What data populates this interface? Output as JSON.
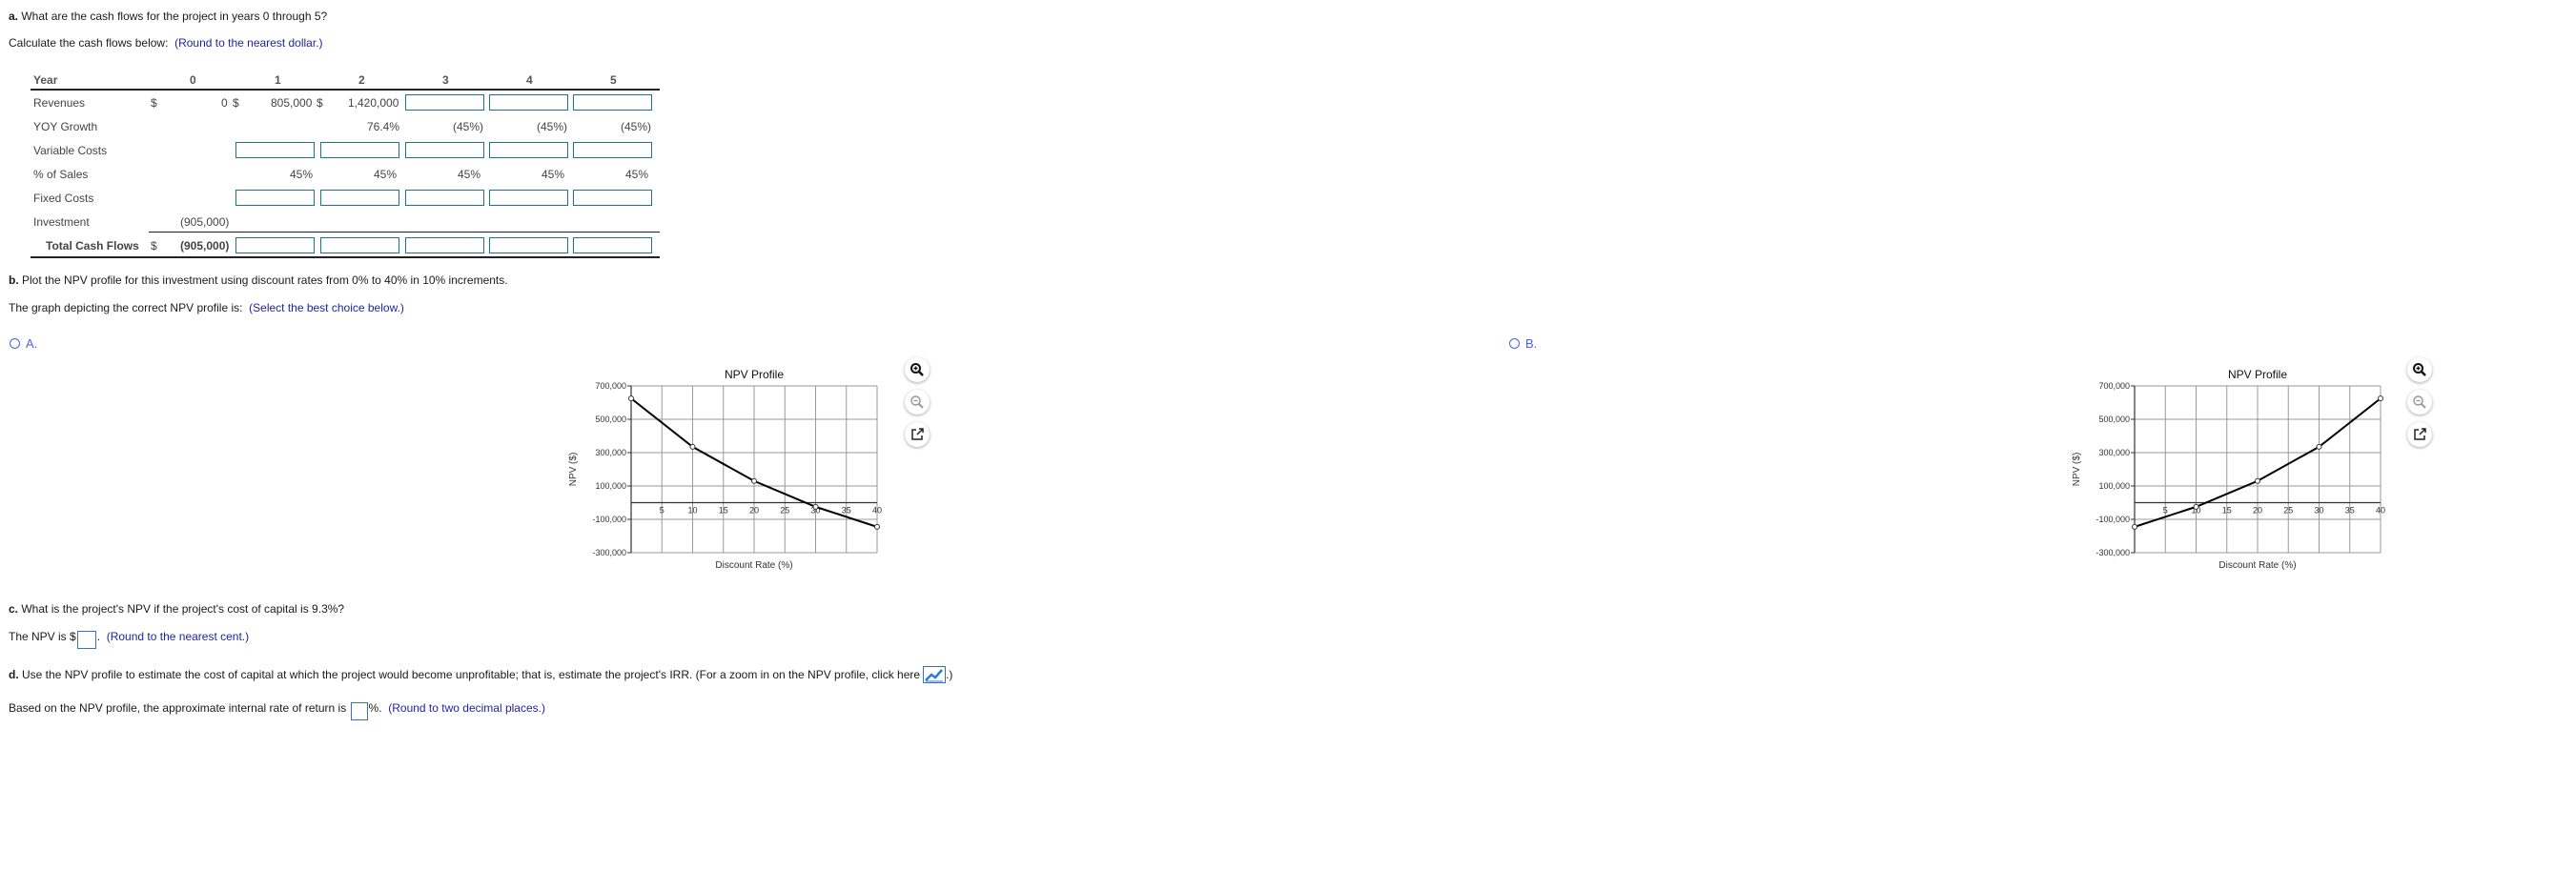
{
  "part_a": {
    "question_letter": "a.",
    "question": " What are the cash flows for the project in years 0 through 5?",
    "instruction": "Calculate the cash flows below:",
    "hint": "(Round to the nearest dollar.)"
  },
  "table": {
    "year_label": "Year",
    "years": [
      "0",
      "1",
      "2",
      "3",
      "4",
      "5"
    ],
    "rows": {
      "revenues": {
        "label": "Revenues",
        "currency": "$",
        "y0": "0",
        "y1": "805,000",
        "y2": "1,420,000",
        "dollar_y0": "$",
        "dollar_y1": "$"
      },
      "yoy_growth": {
        "label": "YOY Growth",
        "y2": "76.4%",
        "y3": "(45%)",
        "y4": "(45%)",
        "y5": "(45%)"
      },
      "variable_costs": {
        "label": "Variable Costs"
      },
      "pct_of_sales": {
        "label": "% of Sales",
        "y1": "45%",
        "y2": "45%",
        "y3": "45%",
        "y4": "45%",
        "y5": "45%"
      },
      "fixed_costs": {
        "label": "Fixed Costs"
      },
      "investment": {
        "label": "Investment",
        "y0": "(905,000)"
      },
      "total_cash_flows": {
        "label": "Total Cash Flows",
        "currency": "$",
        "y0": "(905,000)"
      }
    }
  },
  "part_b": {
    "question_letter": "b.",
    "question": " Plot the NPV profile for this investment using discount rates from 0% to 40% in 10% increments.",
    "instruction": "The graph depicting the correct NPV profile is:",
    "hint": "(Select the best choice below.)",
    "options": [
      {
        "label": "A."
      },
      {
        "label": "B."
      }
    ]
  },
  "chart_data": [
    {
      "type": "line",
      "option": "A",
      "title": "NPV Profile",
      "xlabel": "Discount Rate (%)",
      "ylabel": "NPV ($)",
      "x": [
        0,
        10,
        20,
        30,
        40
      ],
      "series": [
        {
          "name": "NPV",
          "values": [
            625000,
            335000,
            130000,
            -25000,
            -145000
          ]
        }
      ],
      "xlim": [
        0,
        40
      ],
      "ylim": [
        -300000,
        700000
      ],
      "xticks": [
        "5",
        "10",
        "15",
        "20",
        "25",
        "30",
        "35",
        "40"
      ],
      "xtick_values": [
        5,
        10,
        15,
        20,
        25,
        30,
        35,
        40
      ],
      "yticks": [
        "700,000",
        "500,000",
        "300,000",
        "100,000",
        "-100,000",
        "-300,000"
      ],
      "ytick_values": [
        700000,
        500000,
        300000,
        100000,
        -100000,
        -300000
      ],
      "grid": true
    },
    {
      "type": "line",
      "option": "B",
      "title": "NPV Profile",
      "xlabel": "Discount Rate (%)",
      "ylabel": "NPV ($)",
      "x": [
        0,
        10,
        20,
        30,
        40
      ],
      "series": [
        {
          "name": "NPV",
          "values": [
            -145000,
            -25000,
            130000,
            335000,
            625000
          ]
        }
      ],
      "xlim": [
        0,
        40
      ],
      "ylim": [
        -300000,
        700000
      ],
      "xticks": [
        "5",
        "10",
        "15",
        "20",
        "25",
        "30",
        "35",
        "40"
      ],
      "xtick_values": [
        5,
        10,
        15,
        20,
        25,
        30,
        35,
        40
      ],
      "yticks": [
        "700,000",
        "500,000",
        "300,000",
        "100,000",
        "-100,000",
        "-300,000"
      ],
      "ytick_values": [
        700000,
        500000,
        300000,
        100000,
        -100000,
        -300000
      ],
      "grid": true
    }
  ],
  "chart_icons": [
    "zoom-in-icon",
    "zoom-out-icon",
    "open-external-icon"
  ],
  "part_c": {
    "question_letter": "c.",
    "question": " What is the project's NPV if the project's cost of capital is 9.3%?",
    "answer_prefix": "The NPV is $",
    "answer_suffix": ".",
    "hint": "(Round to the nearest cent.)"
  },
  "part_d": {
    "question_letter": "d.",
    "question": " Use the NPV profile to estimate the cost of capital at which the project would become unprofitable; that is, estimate the project's IRR. (For a zoom in on the NPV profile, click here",
    "question_end": ".)",
    "answer_prefix": "Based on the NPV profile, the approximate internal rate of return is",
    "answer_suffix": "%.",
    "hint": "(Round to two decimal places.)"
  },
  "colors": {
    "hint": "#1f1fa0",
    "input_border": "#1b7590",
    "option": "#4a63d9"
  }
}
